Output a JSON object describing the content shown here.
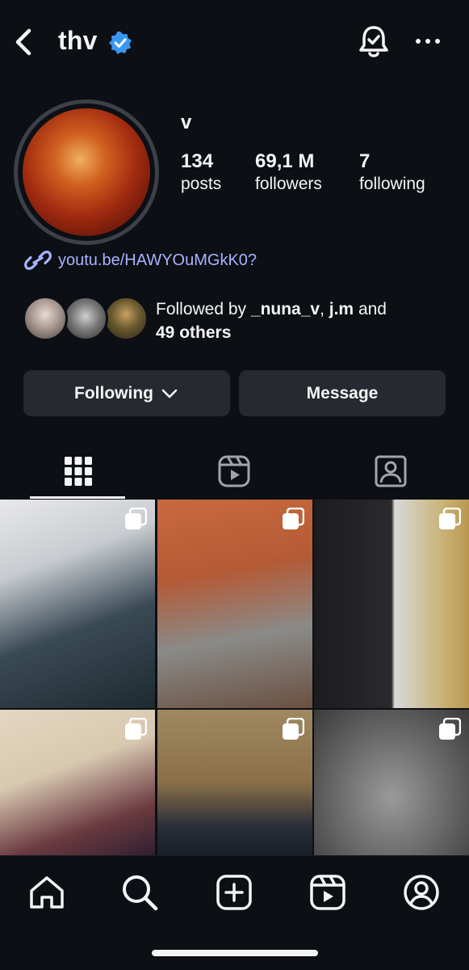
{
  "header": {
    "username": "thv",
    "icons": [
      "back-arrow-icon",
      "verified-badge-icon",
      "notification-bell-icon",
      "more-options-icon"
    ]
  },
  "profile": {
    "display_name": "v",
    "stats": [
      {
        "value": "134",
        "label": "posts"
      },
      {
        "value": "69,1 M",
        "label": "followers"
      },
      {
        "value": "7",
        "label": "following"
      }
    ],
    "link": "youtu.be/HAWYOuMGkK0?",
    "followed_by": {
      "prefix": "Followed by ",
      "user1": "_nuna_v",
      "sep": ", ",
      "user2": "j.m",
      "mid": " and",
      "others": "49 others"
    }
  },
  "actions": {
    "following_label": "Following",
    "message_label": "Message"
  },
  "tabs": [
    "grid-tab",
    "reels-tab",
    "tagged-tab"
  ],
  "colors": {
    "background": "#0c0f14",
    "button": "#26292f",
    "link": "#a8b2ff",
    "verified": "#3897f0"
  },
  "bottom_nav": [
    "home-icon",
    "search-icon",
    "create-icon",
    "reels-icon",
    "profile-icon"
  ]
}
